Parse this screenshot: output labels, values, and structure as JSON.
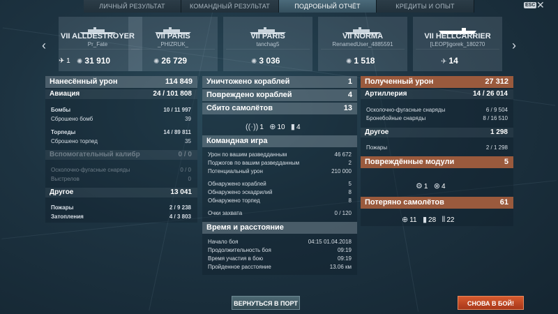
{
  "tabs": [
    "ЛИЧНЫЙ РЕЗУЛЬТАТ",
    "КОМАНДНЫЙ РЕЗУЛЬТАТ",
    "ПОДРОБНЫЙ ОТЧЁТ",
    "КРЕДИТЫ И ОПЫТ"
  ],
  "esc_label": "ESC",
  "close_glyph": "✕",
  "ships": [
    {
      "name": "VII ALLDESTROYER",
      "player": "Pr_Fate",
      "kills": "1",
      "damage": "31 910"
    },
    {
      "name": "VII PARIS",
      "player": "_PHIZRUK_",
      "kills": "",
      "damage": "26 729"
    },
    {
      "name": "VII PARIS",
      "player": "tanchag5",
      "kills": "",
      "damage": "3 036"
    },
    {
      "name": "VII NORMA",
      "player": "RenamedUser_4885591",
      "kills": "",
      "damage": "1 518"
    },
    {
      "name": "VII HELLCARRIER",
      "player": "[LEOP]igorek_180270",
      "kills": "",
      "damage": "14"
    }
  ],
  "damage_panel": {
    "title": "Нанесённый урон",
    "total": "114 849",
    "aviation": {
      "label": "Авиация",
      "value": "24 / 101 808"
    },
    "aviation_rows": [
      {
        "label": "Бомбы",
        "value": "10 / 11 997",
        "bold": true
      },
      {
        "label": "Сброшено бомб",
        "value": "39",
        "bold": false
      },
      {
        "label": "Торпеды",
        "value": "14 / 89 811",
        "bold": true
      },
      {
        "label": "Сброшено торпед",
        "value": "35",
        "bold": false
      }
    ],
    "secondary": {
      "label": "Вспомогательный калибр",
      "value": "0 / 0"
    },
    "secondary_rows": [
      {
        "label": "Осколочно-фугасные снаряды",
        "value": "0 / 0"
      },
      {
        "label": "Выстрелов",
        "value": "0"
      }
    ],
    "other": {
      "label": "Другое",
      "value": "13 041"
    },
    "other_rows": [
      {
        "label": "Пожары",
        "value": "2 / 9 238"
      },
      {
        "label": "Затопления",
        "value": "4 / 3 803"
      }
    ]
  },
  "middle_panel": {
    "destroyed": {
      "label": "Уничтожено кораблей",
      "value": "1"
    },
    "damaged": {
      "label": "Повреждено кораблей",
      "value": "4"
    },
    "planes_shot": {
      "label": "Сбито самолётов",
      "value": "13"
    },
    "plane_icons": [
      {
        "icon": "radar-icon",
        "glyph": "((·))",
        "value": "1"
      },
      {
        "icon": "crosshair-icon",
        "glyph": "⊕",
        "value": "10"
      },
      {
        "icon": "bomb-icon",
        "glyph": "▮",
        "value": "4"
      }
    ],
    "team_title": "Командная игра",
    "team_rows": [
      {
        "label": "Урон по вашим разведданным",
        "value": "46 672"
      },
      {
        "label": "Поджогов по вашим разведданным",
        "value": "2"
      },
      {
        "label": "Потенциальный урон",
        "value": "210 000"
      },
      {
        "label": "Обнаружено кораблей",
        "value": "5"
      },
      {
        "label": "Обнаружено эскадрилий",
        "value": "8"
      },
      {
        "label": "Обнаружено торпед",
        "value": "8"
      },
      {
        "label": "Очки захвата",
        "value": "0 / 120"
      }
    ],
    "time_title": "Время и расстояние",
    "time_rows": [
      {
        "label": "Начало боя",
        "value": "04:15  01.04.2018"
      },
      {
        "label": "Продолжительность боя",
        "value": "09:19"
      },
      {
        "label": "Время участия в бою",
        "value": "09:19"
      },
      {
        "label": "Пройденное расстояние",
        "value": "13.06 км"
      }
    ]
  },
  "received_panel": {
    "title": "Полученный урон",
    "total": "27 312",
    "artillery": {
      "label": "Артиллерия",
      "value": "14 / 26 014"
    },
    "artillery_rows": [
      {
        "label": "Осколочно-фугасные снаряды",
        "value": "6 / 9 504"
      },
      {
        "label": "Бронебойные снаряды",
        "value": "8 / 16 510"
      }
    ],
    "other": {
      "label": "Другое",
      "value": "1 298"
    },
    "other_rows": [
      {
        "label": "Пожары",
        "value": "2 / 1 298"
      }
    ],
    "modules": {
      "label": "Повреждённые модули",
      "value": "5"
    },
    "module_icons": [
      {
        "icon": "module-steering-icon",
        "glyph": "⚙",
        "value": "1"
      },
      {
        "icon": "module-engine-icon",
        "glyph": "⊗",
        "value": "4"
      }
    ],
    "planes_lost": {
      "label": "Потеряно самолётов",
      "value": "61"
    },
    "lost_icons": [
      {
        "icon": "fighter-icon",
        "glyph": "⊕",
        "value": "11"
      },
      {
        "icon": "bomber-icon",
        "glyph": "▮",
        "value": "28"
      },
      {
        "icon": "torpedo-bomber-icon",
        "glyph": "⦀",
        "value": "22"
      }
    ]
  },
  "buttons": {
    "port": "ВЕРНУТЬСЯ В ПОРТ",
    "battle": "СНОВА В БОЙ!"
  }
}
